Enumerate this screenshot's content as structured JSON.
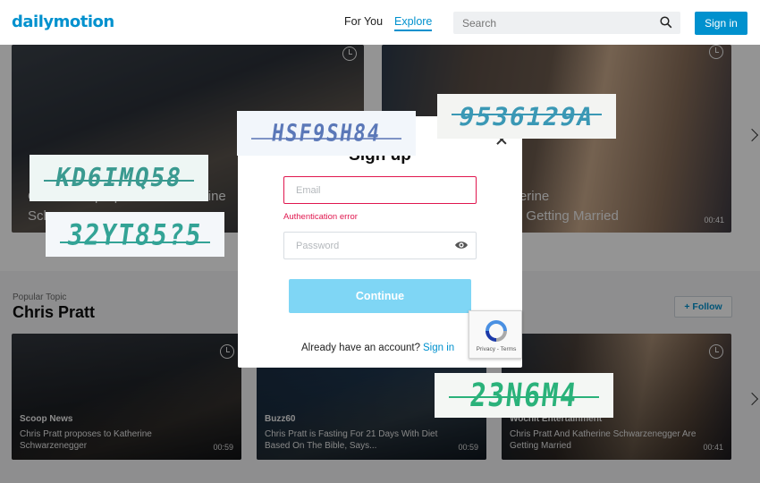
{
  "header": {
    "logo": "dailymotion",
    "nav": [
      "For You",
      "Explore"
    ],
    "search_placeholder": "Search",
    "signin_label": "Sign in"
  },
  "hero": [
    {
      "title_line1": "Chris Pratt proposes to Katherine",
      "title_line2": "Schwarzenegger",
      "duration": ""
    },
    {
      "title_line1": "Chris Pratt And Katherine",
      "title_line2": "Schwarzenegger Are Getting Married",
      "duration": "00:41"
    }
  ],
  "topic": {
    "label": "Popular Topic",
    "title": "Chris Pratt",
    "follow_label": "Follow"
  },
  "videos": [
    {
      "channel": "Scoop News",
      "title": "Chris Pratt proposes to Katherine Schwarzenegger",
      "duration": "00:59"
    },
    {
      "channel": "Buzz60",
      "title": "Chris Pratt is Fasting For 21 Days With Diet Based On The Bible, Says...",
      "duration": "00:59"
    },
    {
      "channel": "Wochit Entertainment",
      "title": "Chris Pratt And Katherine Schwarzenegger Are Getting Married",
      "duration": "00:41"
    }
  ],
  "modal": {
    "title": "Sign up",
    "email_placeholder": "Email",
    "error": "Authentication error",
    "password_placeholder": "Password",
    "continue_label": "Continue",
    "already": "Already have an account?",
    "signin_link": "Sign in",
    "recaptcha_terms": "Privacy - Terms"
  },
  "captchas": [
    "HSF9SH84",
    "9536129A",
    "KD6IMQ58",
    "32YT85?5",
    "23N6M4"
  ],
  "colors": {
    "brand": "#0091ce",
    "error": "#e0174f",
    "continue": "#7fd6f5"
  }
}
